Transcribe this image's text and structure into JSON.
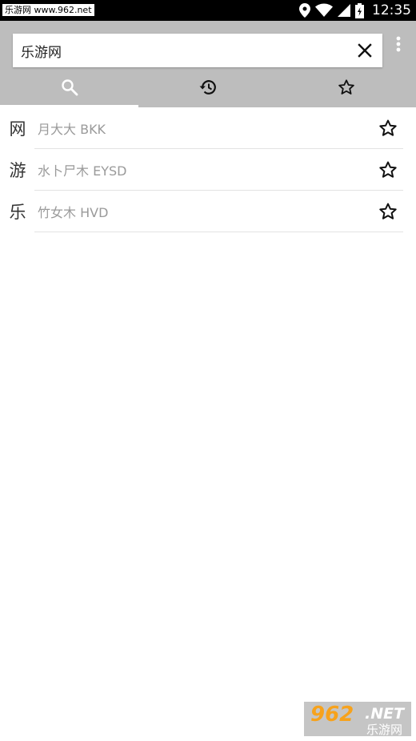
{
  "status_bar": {
    "watermark": "乐游网 www.962.net",
    "time": "12:35"
  },
  "search": {
    "value": "乐游网",
    "clear_icon": "close-icon",
    "menu_icon": "more-vert-icon"
  },
  "tabs": [
    {
      "icon": "search-icon",
      "active": true
    },
    {
      "icon": "history-icon",
      "active": false
    },
    {
      "icon": "star-outline-icon",
      "active": false
    }
  ],
  "results": [
    {
      "char": "网",
      "desc": "月大大  BKK"
    },
    {
      "char": "游",
      "desc": "水卜尸木  EYSD"
    },
    {
      "char": "乐",
      "desc": "竹女木  HVD"
    }
  ],
  "watermark_bottom": {
    "digits": "962",
    "net": ".NET",
    "site": "乐游网"
  },
  "colors": {
    "toolbar": "#bdbdbd",
    "status_bar": "#000000",
    "accent": "#f7a21b"
  }
}
